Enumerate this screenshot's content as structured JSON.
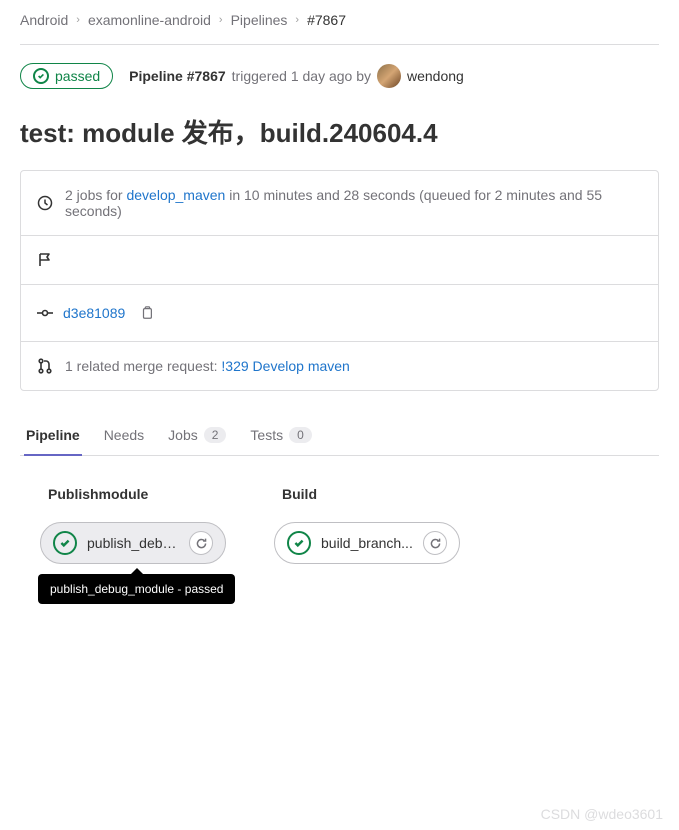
{
  "breadcrumb": {
    "items": [
      "Android",
      "examonline-android",
      "Pipelines"
    ],
    "current": "#7867"
  },
  "status": {
    "label": "passed"
  },
  "pipeline_info": {
    "prefix_bold": "Pipeline #7867",
    "triggered_text": "triggered 1 day ago by",
    "user": "wendong"
  },
  "title": "test: module 发布，build.240604.4",
  "jobs_summary": {
    "before_link": "2 jobs for ",
    "branch_link": "develop_maven",
    "after_link": " in 10 minutes and 28 seconds (queued for 2 minutes and 55 seconds)"
  },
  "commit": {
    "sha": "d3e81089"
  },
  "merge_request": {
    "prefix": "1 related merge request: ",
    "link": "!329 Develop maven"
  },
  "tabs": {
    "pipeline": "Pipeline",
    "needs": "Needs",
    "jobs": "Jobs",
    "jobs_count": "2",
    "tests": "Tests",
    "tests_count": "0"
  },
  "stages": [
    {
      "name": "Publishmodule",
      "job": "publish_debu...",
      "tooltip": "publish_debug_module - passed",
      "hovered": true
    },
    {
      "name": "Build",
      "job": "build_branch...",
      "hovered": false
    }
  ],
  "watermark": "CSDN @wdeo3601"
}
